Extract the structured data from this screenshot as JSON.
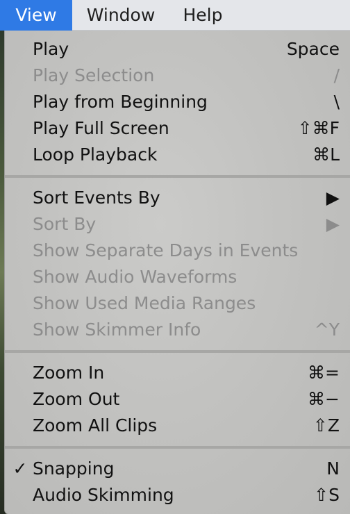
{
  "menubar": {
    "items": [
      {
        "label": "View",
        "active": true
      },
      {
        "label": "Window",
        "active": false
      },
      {
        "label": "Help",
        "active": false
      }
    ]
  },
  "menu": {
    "groups": [
      [
        {
          "label": "Play",
          "shortcut": "Space",
          "enabled": true
        },
        {
          "label": "Play Selection",
          "shortcut": "/",
          "enabled": false
        },
        {
          "label": "Play from Beginning",
          "shortcut": "\\",
          "enabled": true
        },
        {
          "label": "Play Full Screen",
          "shortcut": "⇧⌘F",
          "enabled": true
        },
        {
          "label": "Loop Playback",
          "shortcut": "⌘L",
          "enabled": true
        }
      ],
      [
        {
          "label": "Sort Events By",
          "shortcut": "▶",
          "enabled": true
        },
        {
          "label": "Sort By",
          "shortcut": "▶",
          "enabled": false
        },
        {
          "label": "Show Separate Days in Events",
          "shortcut": "",
          "enabled": false
        },
        {
          "label": "Show Audio Waveforms",
          "shortcut": "",
          "enabled": false
        },
        {
          "label": "Show Used Media Ranges",
          "shortcut": "",
          "enabled": false
        },
        {
          "label": "Show Skimmer Info",
          "shortcut": "^Y",
          "enabled": false
        }
      ],
      [
        {
          "label": "Zoom In",
          "shortcut": "⌘=",
          "enabled": true
        },
        {
          "label": "Zoom Out",
          "shortcut": "⌘−",
          "enabled": true
        },
        {
          "label": "Zoom All Clips",
          "shortcut": "⇧Z",
          "enabled": true
        }
      ],
      [
        {
          "label": "Snapping",
          "shortcut": "N",
          "enabled": true,
          "checked": true,
          "check_mark": "✓"
        },
        {
          "label": "Audio Skimming",
          "shortcut": "⇧S",
          "enabled": true
        }
      ]
    ]
  }
}
